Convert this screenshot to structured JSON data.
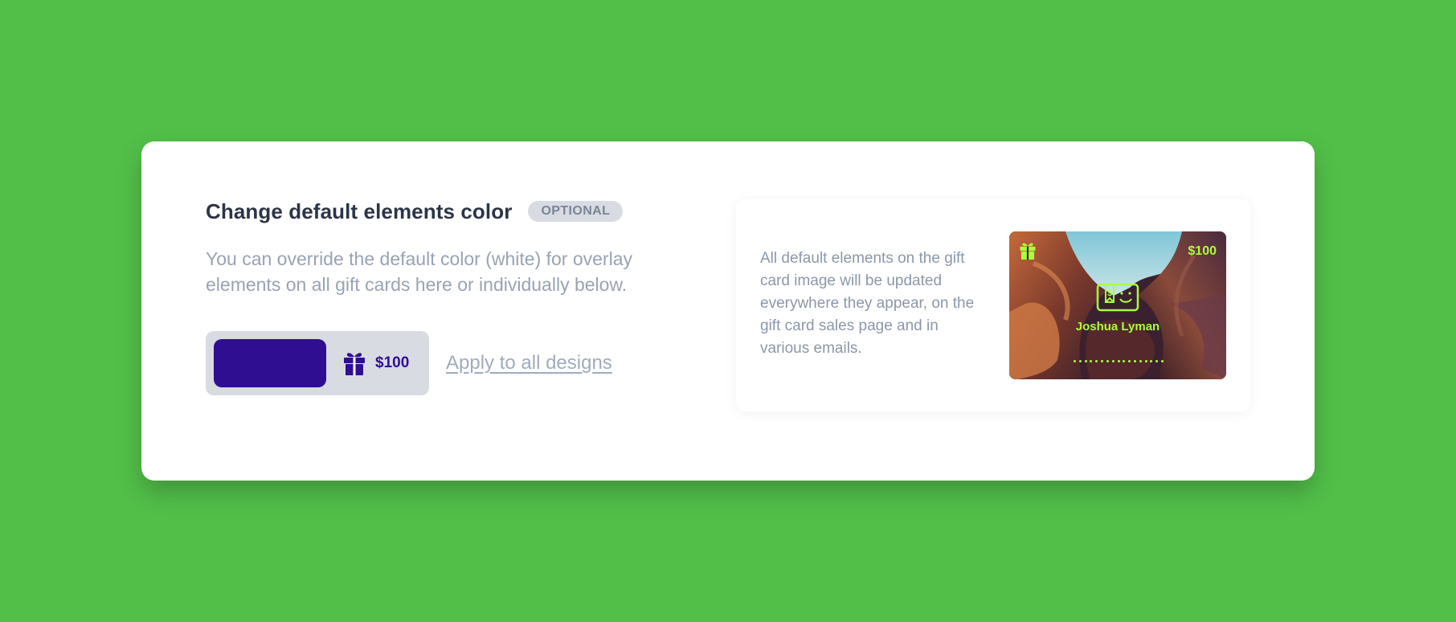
{
  "section": {
    "title": "Change default elements color",
    "badge": "OPTIONAL",
    "description": "You can override the default color (white) for overlay elements on all gift cards here or individually below."
  },
  "color_picker": {
    "selected_color": "#2f0e92",
    "sample_icon": "gift-icon",
    "sample_price": "$100"
  },
  "apply_link": "Apply to all designs",
  "preview": {
    "note": "All default elements on the gift card image will be updated everywhere they appear, on the gift card sales page and in various emails.",
    "gift_card": {
      "price": "$100",
      "name": "Joshua Lyman",
      "accent_color": "#a8ff3c",
      "icons": [
        "gift-icon",
        "gift-card-logo-icon"
      ]
    }
  },
  "colors": {
    "background": "#52bf49",
    "title": "#2b3547",
    "muted_text": "#98a3b4",
    "badge_bg": "#d8dbe2"
  }
}
